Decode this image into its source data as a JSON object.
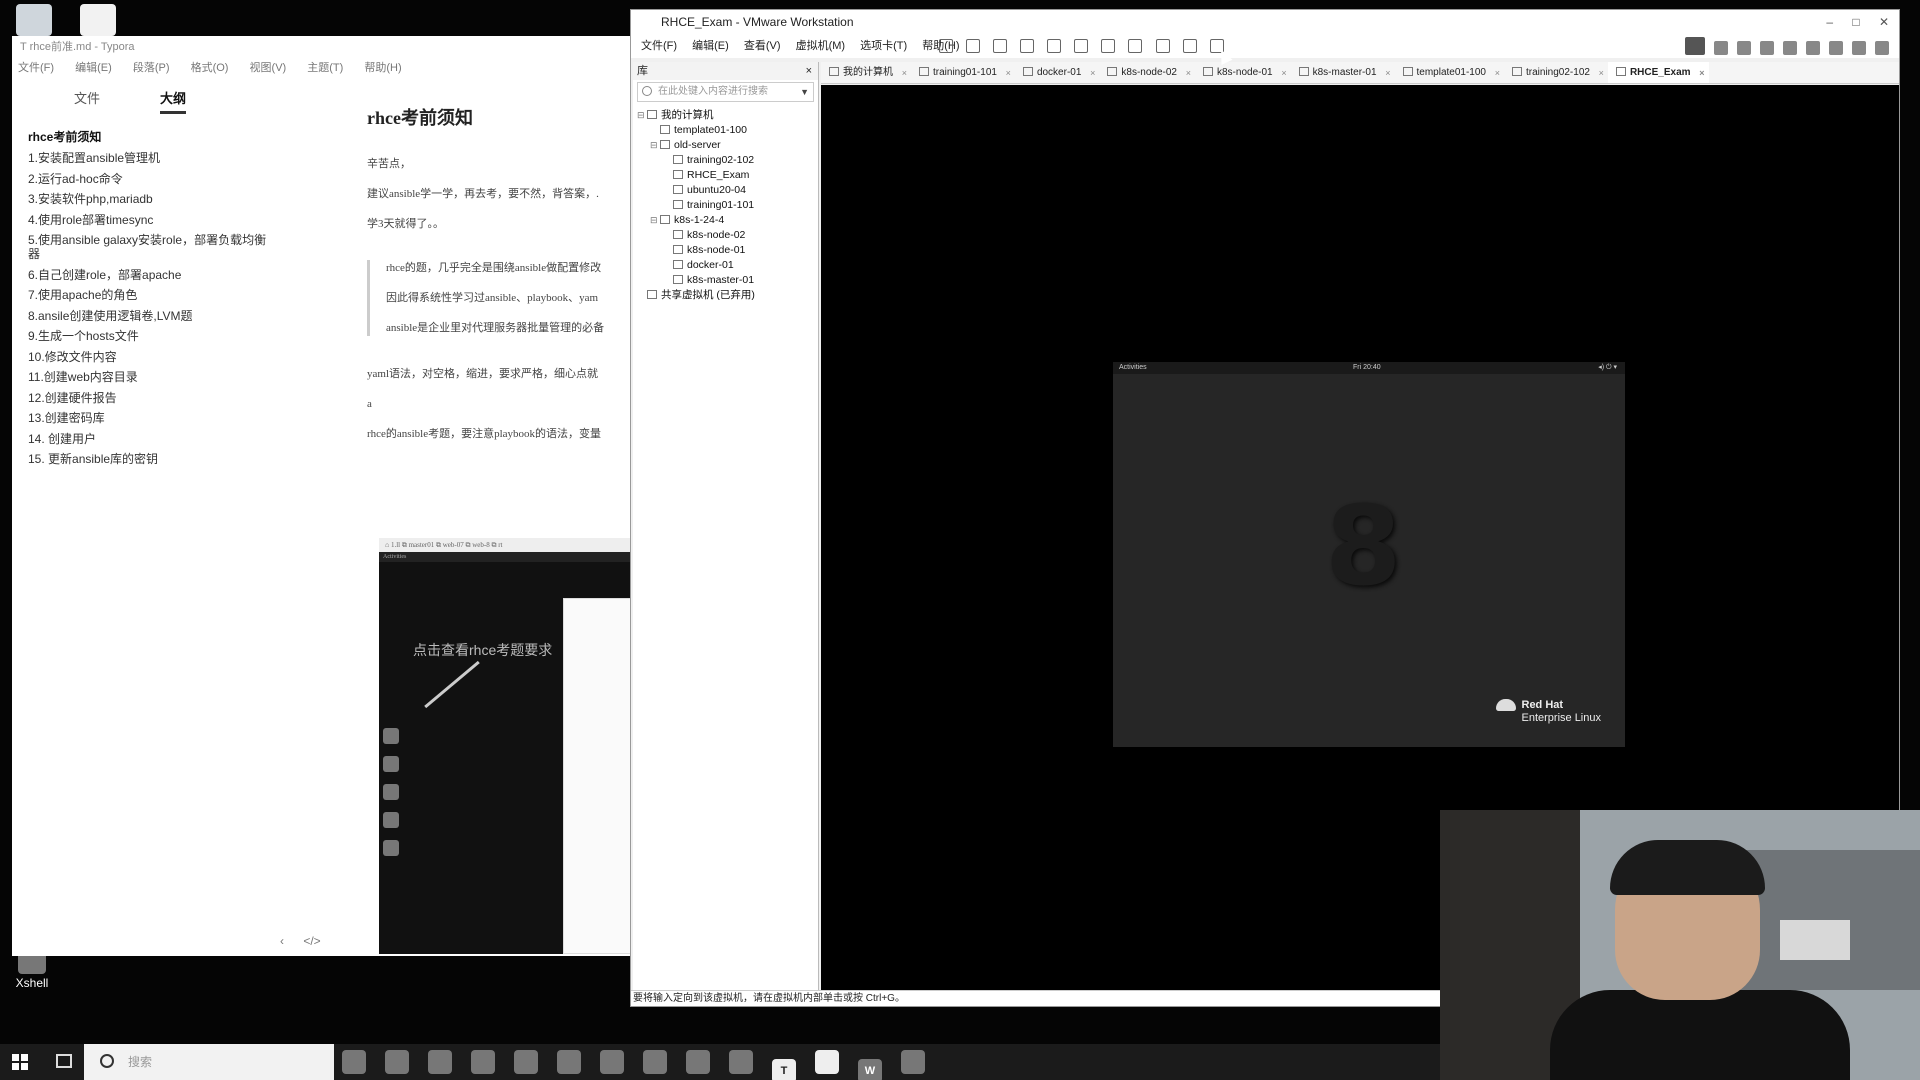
{
  "desktop": {
    "icons": [
      {
        "label": "",
        "icon": "recycle-bin-icon"
      },
      {
        "label": "",
        "icon": "vmware-shortcut-icon"
      },
      {
        "label": "Xshell",
        "icon": "xshell-icon"
      }
    ]
  },
  "typora": {
    "title": "T rhce前准.md - Typora",
    "menu": [
      "文件(F)",
      "编辑(E)",
      "段落(P)",
      "格式(O)",
      "视图(V)",
      "主题(T)",
      "帮助(H)"
    ],
    "sidebar_tabs": [
      "文件",
      "大纲"
    ],
    "active_tab": "大纲",
    "outline_heading": "rhce考前须知",
    "outline_items": [
      "1.安装配置ansible管理机",
      "2.运行ad-hoc命令",
      "3.安装软件php,mariadb",
      "4.使用role部署timesync",
      "5.使用ansible galaxy安装role，部署负载均衡器",
      "6.自己创建role，部署apache",
      "7.使用apache的角色",
      "8.ansile创建使用逻辑卷,LVM题",
      "9.生成一个hosts文件",
      "10.修改文件内容",
      "11.创建web内容目录",
      "12.创建硬件报告",
      "13.创建密码库",
      "14. 创建用户",
      "15. 更新ansible库的密钥"
    ],
    "nav_back": "‹",
    "nav_source": "</>",
    "editor": {
      "title": "rhce考前须知",
      "p1": "辛苦点，",
      "p2": "建议ansible学一学，再去考，要不然，背答案，.",
      "p3": "学3天就得了。。",
      "quote1": "rhce的题，几乎完全是围绕ansible做配置修改",
      "quote2": "因此得系统性学习过ansible、playbook、yam",
      "quote3": "ansible是企业里对代理服务器批量管理的必备",
      "p4": "yaml语法，对空格，缩进，要求严格，细心点就",
      "p5": "a",
      "p6": "rhce的ansible考题，要注意playbook的语法，变量"
    },
    "embed": {
      "tabs": "⌂ 1.ll   ⧉ master01   ⧉ web-07   ⧉ web-8   ⧉ rt",
      "caption": "点击查看rhce考题要求",
      "activities": "Activities"
    }
  },
  "vmware": {
    "title": "RHCE_Exam - VMware Workstation",
    "menu": [
      "文件(F)",
      "编辑(E)",
      "查看(V)",
      "虚拟机(M)",
      "选项卡(T)",
      "帮助(H)"
    ],
    "library": {
      "header": "库",
      "close": "×",
      "search_placeholder": "在此处键入内容进行搜索",
      "tree": [
        {
          "label": "我的计算机",
          "level": 0,
          "toggle": "⊟"
        },
        {
          "label": "template01-100",
          "level": 1,
          "toggle": ""
        },
        {
          "label": "old-server",
          "level": 1,
          "toggle": "⊟"
        },
        {
          "label": "training02-102",
          "level": 2,
          "toggle": ""
        },
        {
          "label": "RHCE_Exam",
          "level": 2,
          "toggle": ""
        },
        {
          "label": "ubuntu20-04",
          "level": 2,
          "toggle": ""
        },
        {
          "label": "training01-101",
          "level": 2,
          "toggle": ""
        },
        {
          "label": "k8s-1-24-4",
          "level": 1,
          "toggle": "⊟"
        },
        {
          "label": "k8s-node-02",
          "level": 2,
          "toggle": ""
        },
        {
          "label": "k8s-node-01",
          "level": 2,
          "toggle": ""
        },
        {
          "label": "docker-01",
          "level": 2,
          "toggle": ""
        },
        {
          "label": "k8s-master-01",
          "level": 2,
          "toggle": ""
        },
        {
          "label": "共享虚拟机 (已弃用)",
          "level": 0,
          "toggle": ""
        }
      ]
    },
    "tabs": [
      {
        "label": "我的计算机",
        "active": false
      },
      {
        "label": "training01-101",
        "active": false
      },
      {
        "label": "docker-01",
        "active": false
      },
      {
        "label": "k8s-node-02",
        "active": false
      },
      {
        "label": "k8s-node-01",
        "active": false
      },
      {
        "label": "k8s-master-01",
        "active": false
      },
      {
        "label": "template01-100",
        "active": false
      },
      {
        "label": "training02-102",
        "active": false
      },
      {
        "label": "RHCE_Exam",
        "active": true
      }
    ],
    "guest": {
      "activities": "Activities",
      "clock": "Fri 20:40",
      "sys_icons": "◂) ⏻ ▾",
      "logo_number": "8",
      "brand_line1": "Red Hat",
      "brand_line2": "Enterprise Linux"
    },
    "status_text": "要将输入定向到该虚拟机，请在虚拟机内部单击或按 Ctrl+G。"
  },
  "taskbar": {
    "search_placeholder": "搜索",
    "apps": [
      {
        "label": "",
        "icon": "cortana-icon",
        "active": false
      },
      {
        "label": "",
        "icon": "chrome-icon",
        "active": false
      },
      {
        "label": "",
        "icon": "edge-icon",
        "active": false
      },
      {
        "label": "",
        "icon": "vim-icon",
        "active": false
      },
      {
        "label": "",
        "icon": "wechat-icon",
        "active": false
      },
      {
        "label": "",
        "icon": "screenshot-icon",
        "active": false
      },
      {
        "label": "",
        "icon": "notepad-icon",
        "active": false
      },
      {
        "label": "",
        "icon": "store-icon",
        "active": false
      },
      {
        "label": "",
        "icon": "vpn-icon",
        "active": false
      },
      {
        "label": "",
        "icon": "file-explorer-icon",
        "active": false
      },
      {
        "label": "T",
        "icon": "typora-icon",
        "active": true
      },
      {
        "label": "",
        "icon": "vmware-icon",
        "active": true
      },
      {
        "label": "W",
        "icon": "wps-icon",
        "active": false
      },
      {
        "label": "",
        "icon": "remote-desktop-icon",
        "active": false
      }
    ]
  }
}
